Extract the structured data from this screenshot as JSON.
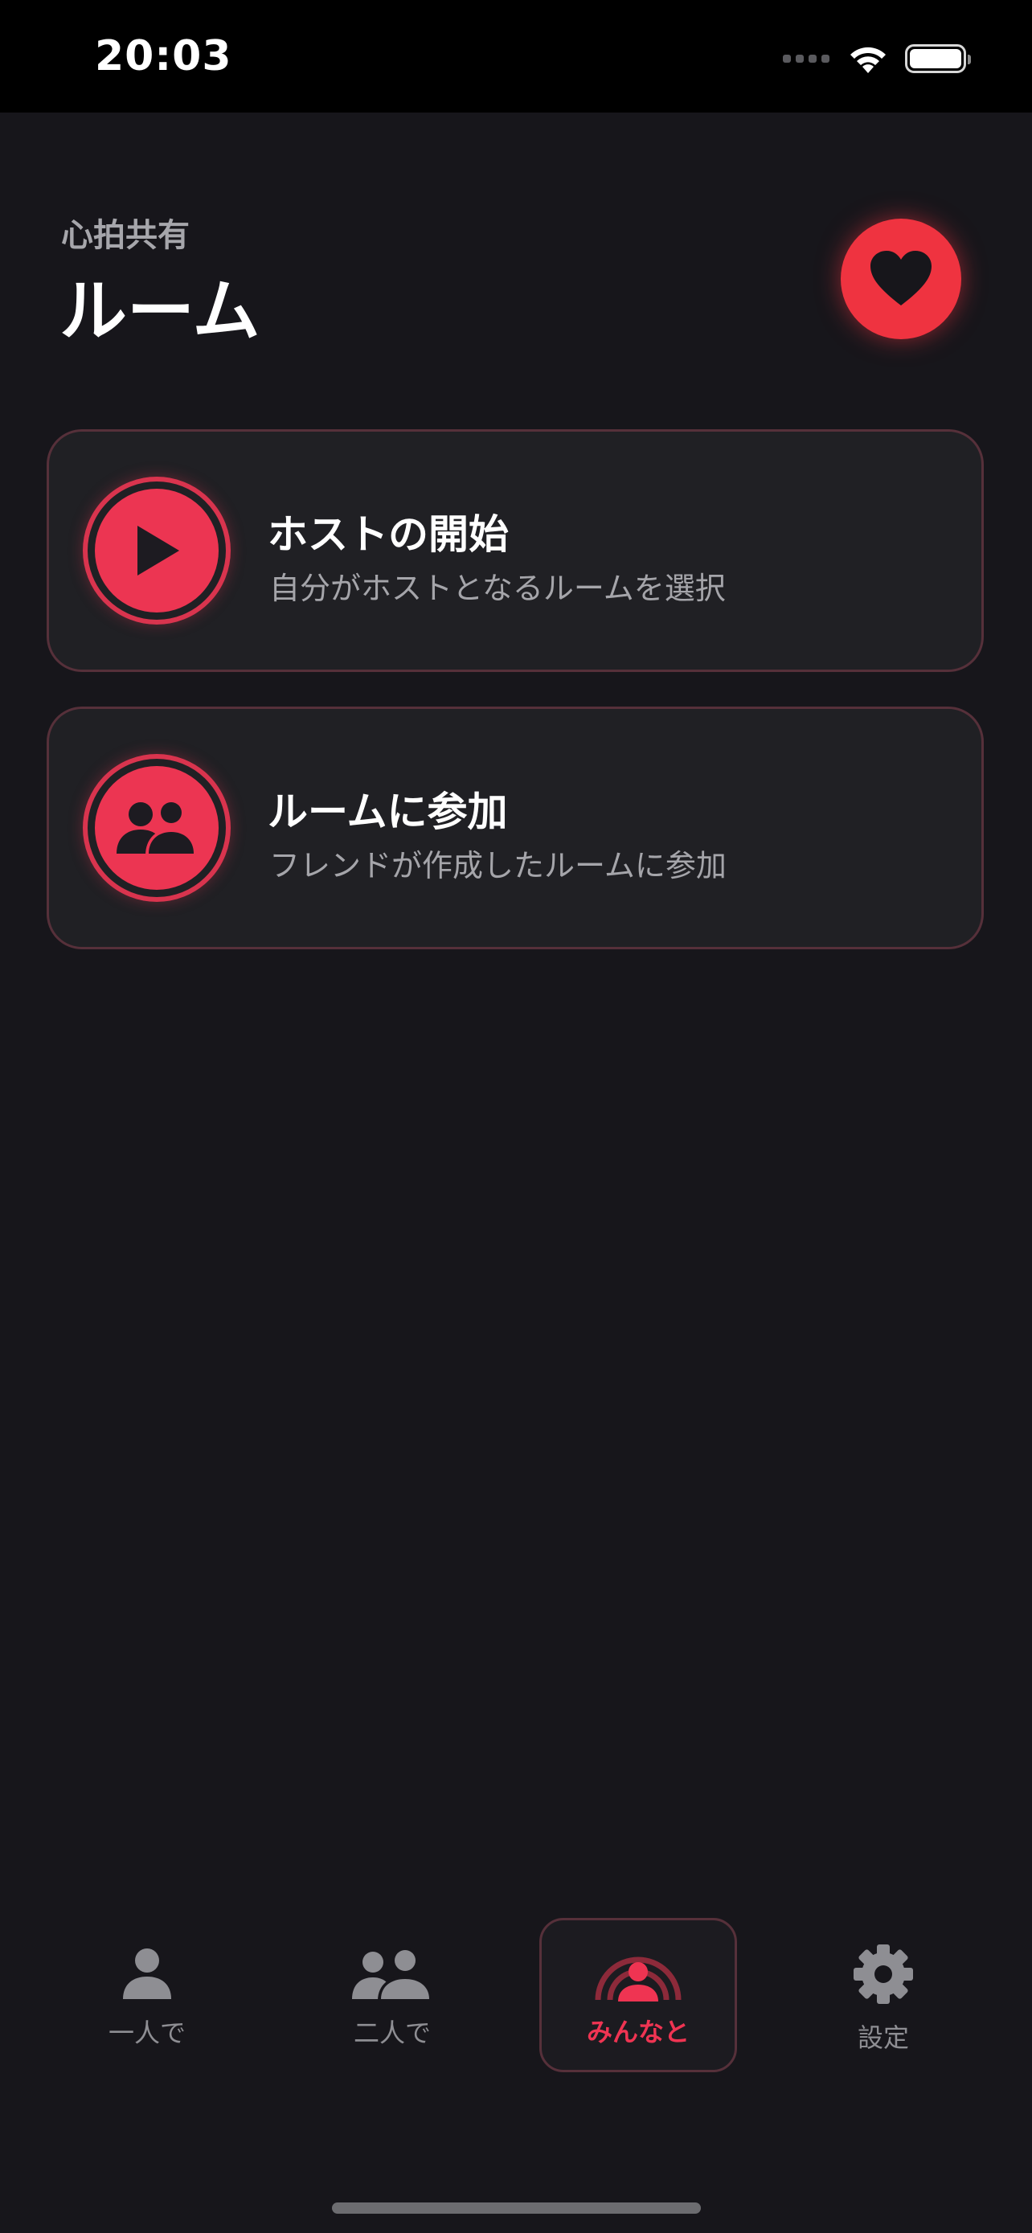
{
  "status_bar": {
    "time": "20:03",
    "icons": [
      "cellular-signal-icon",
      "wifi-icon",
      "battery-icon"
    ]
  },
  "header": {
    "subtitle": "心拍共有",
    "title": "ルーム",
    "icon": "heart-icon"
  },
  "actions": [
    {
      "title": "ホストの開始",
      "description": "自分がホストとなるルームを選択",
      "icon": "play-icon"
    },
    {
      "title": "ルームに参加",
      "description": "フレンドが作成したルームに参加",
      "icon": "people-icon"
    }
  ],
  "tab_bar": {
    "items": [
      {
        "label": "一人で",
        "icon": "person-icon",
        "selected": false
      },
      {
        "label": "二人で",
        "icon": "two-people-icon",
        "selected": false
      },
      {
        "label": "みんなと",
        "icon": "group-broadcast-icon",
        "selected": true
      },
      {
        "label": "設定",
        "icon": "gear-icon",
        "selected": false
      }
    ]
  },
  "colors": {
    "accent": "#ef3340",
    "background": "#17161b",
    "card": "#202024",
    "card_border": "#56303a",
    "inactive": "#8e8e93"
  }
}
